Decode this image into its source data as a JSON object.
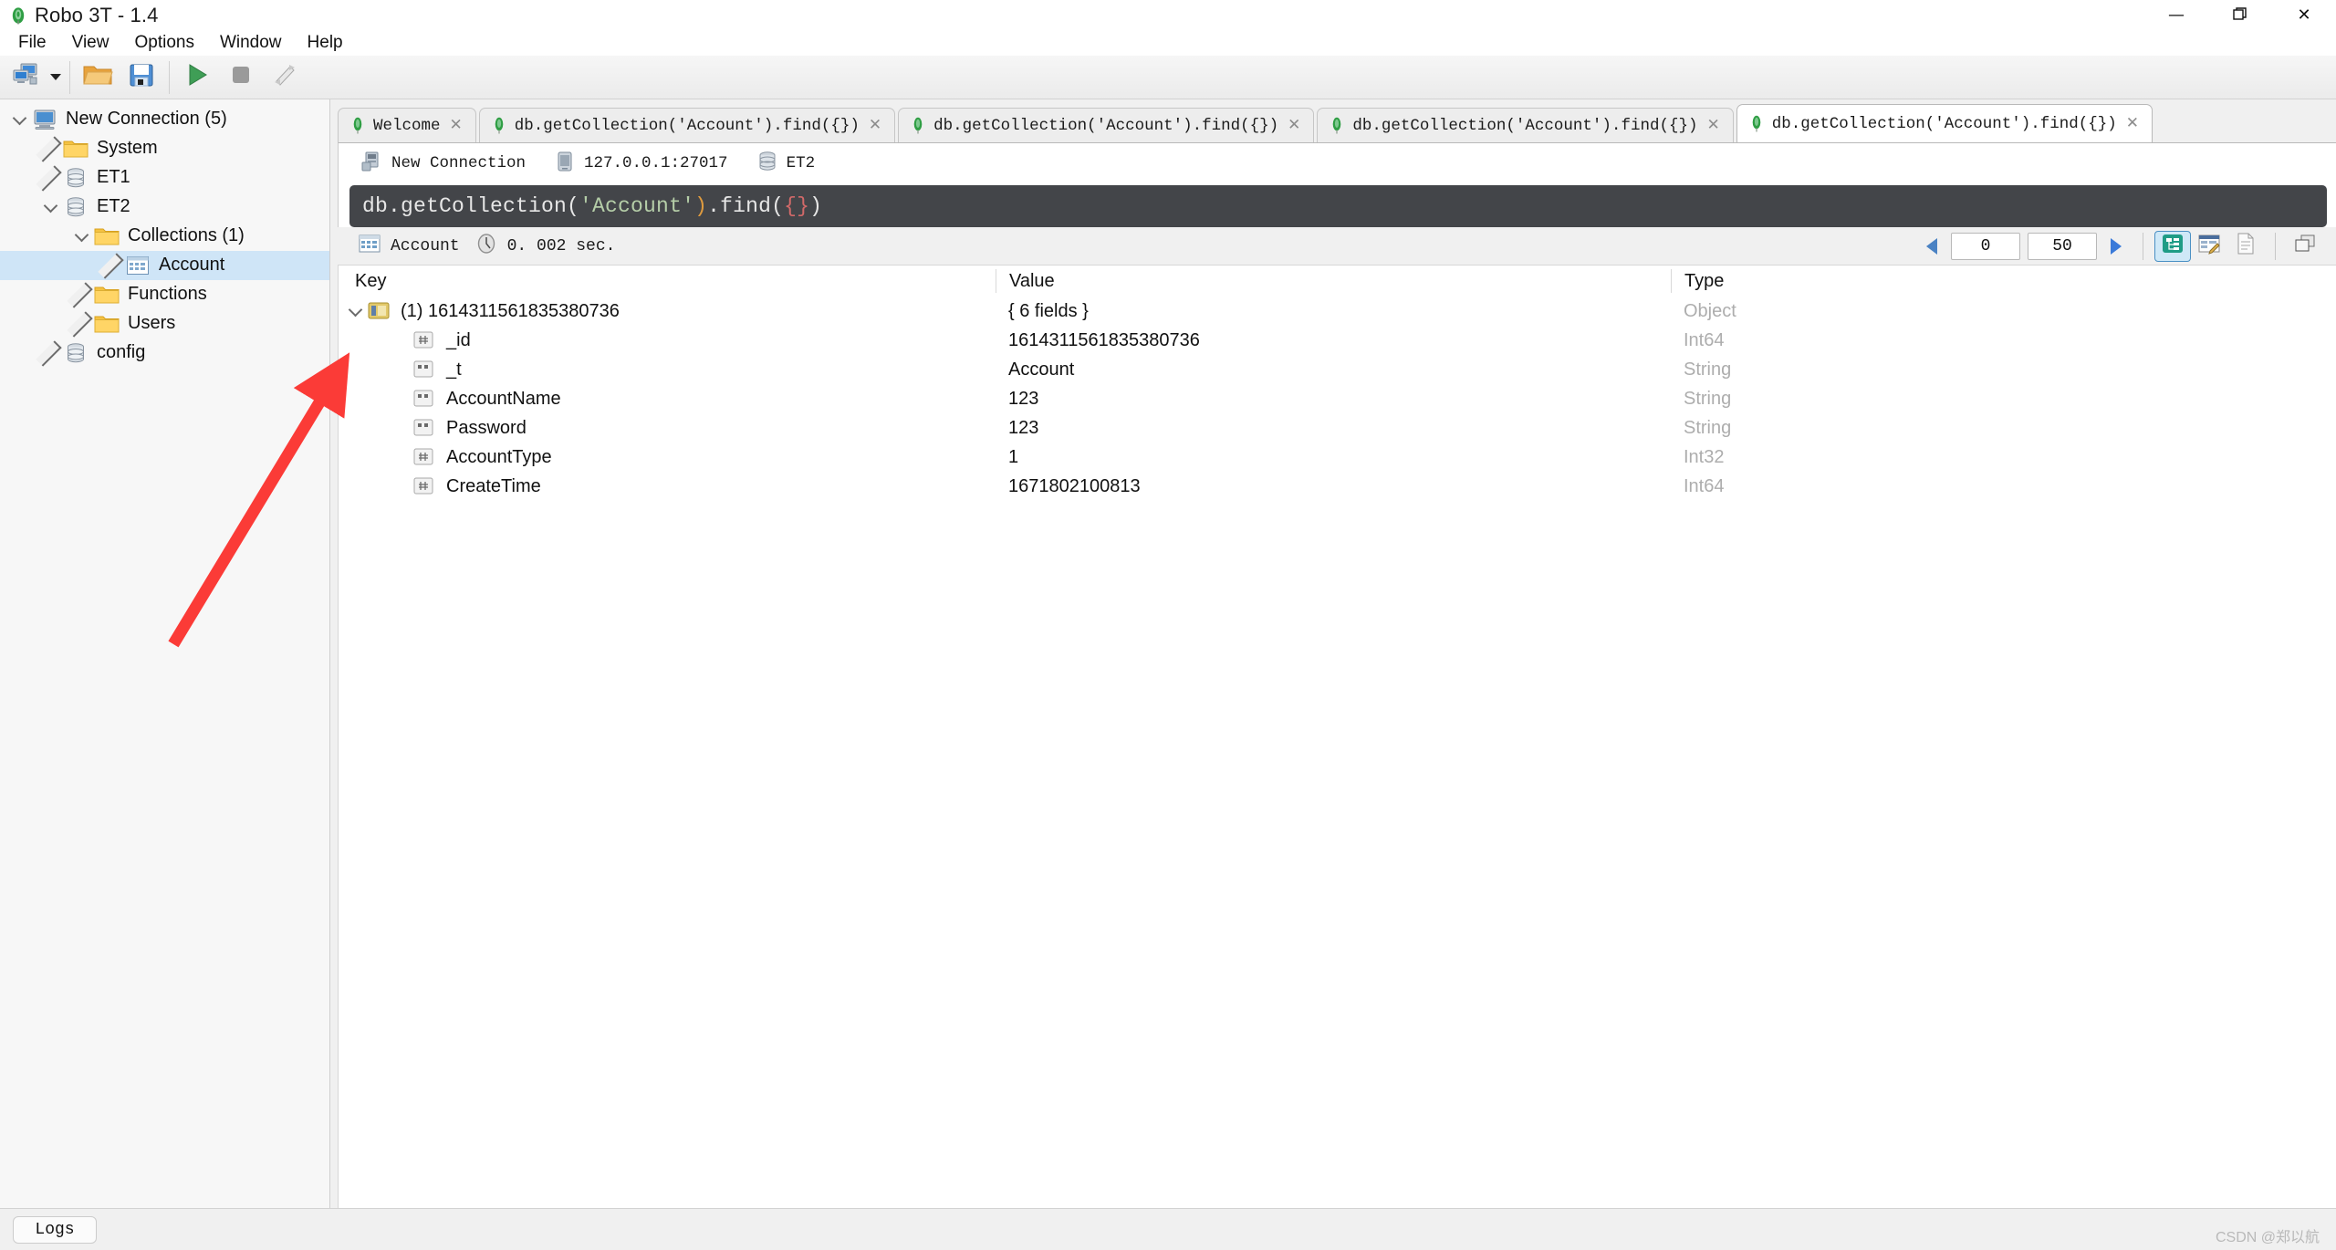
{
  "window": {
    "title": "Robo 3T - 1.4",
    "app_icon": "robo3t-leaf-icon",
    "minimize_glyph": "—",
    "maximize_glyph": "❐",
    "close_glyph": "✕"
  },
  "menubar": {
    "items": [
      {
        "label": "File"
      },
      {
        "label": "View"
      },
      {
        "label": "Options"
      },
      {
        "label": "Window"
      },
      {
        "label": "Help"
      }
    ]
  },
  "toolbar": {
    "buttons": [
      {
        "name": "connect-button",
        "icon": "computers-connect-icon"
      },
      {
        "name": "open-script-button",
        "icon": "folder-open-icon"
      },
      {
        "name": "save-script-button",
        "icon": "floppy-save-icon"
      },
      {
        "name": "execute-button",
        "icon": "play-triangle-icon"
      },
      {
        "name": "stop-button",
        "icon": "stop-square-icon"
      },
      {
        "name": "refresh-button",
        "icon": "rotate-arrows-icon"
      }
    ]
  },
  "sidebar": {
    "tree": [
      {
        "label": "New Connection (5)",
        "icon": "computer-icon",
        "depth": 0,
        "expanded": true,
        "selected": false
      },
      {
        "label": "System",
        "icon": "folder-icon",
        "depth": 1,
        "expanded": false,
        "selected": false
      },
      {
        "label": "ET1",
        "icon": "database-icon",
        "depth": 1,
        "expanded": false,
        "selected": false
      },
      {
        "label": "ET2",
        "icon": "database-icon",
        "depth": 1,
        "expanded": true,
        "selected": false
      },
      {
        "label": "Collections (1)",
        "icon": "folder-icon",
        "depth": 2,
        "expanded": true,
        "selected": false
      },
      {
        "label": "Account",
        "icon": "collection-icon",
        "depth": 3,
        "expanded": false,
        "selected": true
      },
      {
        "label": "Functions",
        "icon": "folder-icon",
        "depth": 2,
        "expanded": false,
        "selected": false
      },
      {
        "label": "Users",
        "icon": "folder-icon",
        "depth": 2,
        "expanded": false,
        "selected": false
      },
      {
        "label": "config",
        "icon": "database-icon",
        "depth": 1,
        "expanded": false,
        "selected": false
      }
    ]
  },
  "tabs": [
    {
      "label": "Welcome",
      "icon": "leaf-icon",
      "active": false,
      "close_glyph": "✕"
    },
    {
      "label": "db.getCollection('Account').find({})",
      "icon": "leaf-icon",
      "active": false,
      "close_glyph": "✕"
    },
    {
      "label": "db.getCollection('Account').find({})",
      "icon": "leaf-icon",
      "active": false,
      "close_glyph": "✕"
    },
    {
      "label": "db.getCollection('Account').find({})",
      "icon": "leaf-icon",
      "active": false,
      "close_glyph": "✕"
    },
    {
      "label": "db.getCollection('Account').find({})",
      "icon": "leaf-icon",
      "active": true,
      "close_glyph": "✕"
    }
  ],
  "connection_bar": {
    "connection_name": "New Connection",
    "connection_icon": "server-icon",
    "host": "127.0.0.1:27017",
    "host_icon": "host-icon",
    "database": "ET2",
    "database_icon": "database-icon"
  },
  "editor": {
    "query_segments": [
      {
        "text": "db.getCollection(",
        "kind": "plain"
      },
      {
        "text": "'Account'",
        "kind": "string"
      },
      {
        "text": ")",
        "kind": "paren"
      },
      {
        "text": ".find(",
        "kind": "plain"
      },
      {
        "text": "{}",
        "kind": "brace"
      },
      {
        "text": ")",
        "kind": "plain"
      }
    ],
    "query_text": "db.getCollection('Account').find({})"
  },
  "results_toolbar": {
    "collection_name": "Account",
    "collection_icon": "collection-icon",
    "clock_icon": "clock-icon",
    "elapsed": "0. 002 sec.",
    "prev_icon": "left-triangle-icon",
    "next_icon": "right-triangle-icon",
    "skip_value": "0",
    "limit_value": "50",
    "view_modes": [
      {
        "name": "tree-view-button",
        "icon": "tree-view-icon",
        "active": true
      },
      {
        "name": "table-view-button",
        "icon": "table-view-icon",
        "active": false
      },
      {
        "name": "text-view-button",
        "icon": "document-text-icon",
        "active": false
      }
    ],
    "window_mode": {
      "name": "cascade-windows-button",
      "icon": "windows-stack-icon"
    }
  },
  "grid": {
    "columns": [
      "Key",
      "Value",
      "Type"
    ],
    "rows": [
      {
        "key": "(1) 1614311561835380736",
        "value": "{ 6 fields }",
        "type": "Object",
        "icon": "document-object-icon",
        "level": 0,
        "expandable": true,
        "expanded": true
      },
      {
        "key": "_id",
        "value": "1614311561835380736",
        "type": "Int64",
        "icon": "int-field-icon",
        "level": 1,
        "expandable": false,
        "expanded": false
      },
      {
        "key": "_t",
        "value": "Account",
        "type": "String",
        "icon": "string-field-icon",
        "level": 1,
        "expandable": false,
        "expanded": false
      },
      {
        "key": "AccountName",
        "value": "123",
        "type": "String",
        "icon": "string-field-icon",
        "level": 1,
        "expandable": false,
        "expanded": false
      },
      {
        "key": "Password",
        "value": "123",
        "type": "String",
        "icon": "string-field-icon",
        "level": 1,
        "expandable": false,
        "expanded": false
      },
      {
        "key": "AccountType",
        "value": "1",
        "type": "Int32",
        "icon": "int-field-icon",
        "level": 1,
        "expandable": false,
        "expanded": false
      },
      {
        "key": "CreateTime",
        "value": "1671802100813",
        "type": "Int64",
        "icon": "int-field-icon",
        "level": 1,
        "expandable": false,
        "expanded": false
      }
    ]
  },
  "statusbar": {
    "logs_label": "Logs",
    "watermark": "CSDN @郑以航"
  },
  "annotation": {
    "arrow_color": "#fb3b37",
    "points_to": "grid-row-expand-twisty"
  },
  "colors": {
    "selection": "#cfe5f7",
    "editor_bg": "#434549",
    "accent_blue": "#3a7ad9",
    "type_text": "#adadad"
  }
}
